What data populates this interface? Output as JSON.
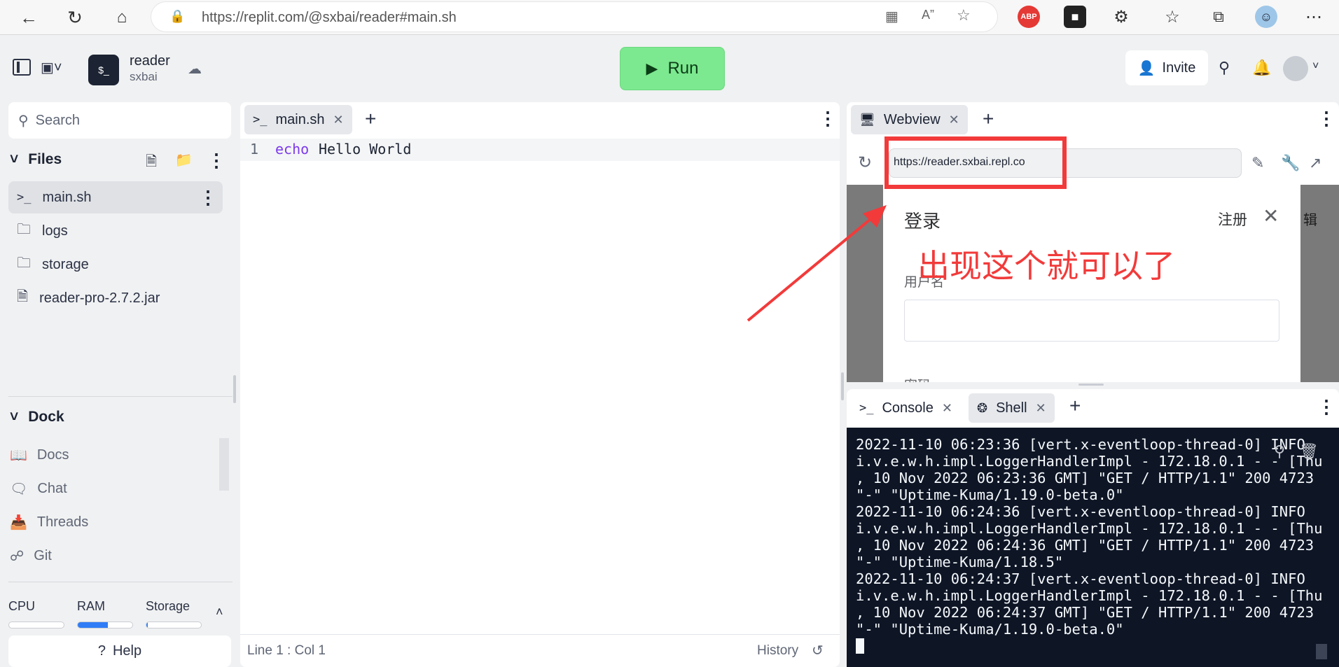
{
  "browser": {
    "url": "https://replit.com/@sxbai/reader#main.sh"
  },
  "header": {
    "repl_name": "reader",
    "owner": "sxbai",
    "run_label": "Run",
    "invite_label": "Invite"
  },
  "sidebar": {
    "search_placeholder": "Search",
    "files_heading": "Files",
    "files": [
      {
        "name": "main.sh",
        "icon": "terminal-icon"
      },
      {
        "name": "logs",
        "icon": "folder-icon"
      },
      {
        "name": "storage",
        "icon": "folder-icon"
      },
      {
        "name": "reader-pro-2.7.2.jar",
        "icon": "file-icon"
      }
    ],
    "dock_heading": "Dock",
    "dock": [
      {
        "name": "Docs",
        "icon": "book-icon"
      },
      {
        "name": "Chat",
        "icon": "chat-icon"
      },
      {
        "name": "Threads",
        "icon": "inbox-icon"
      },
      {
        "name": "Git",
        "icon": "git-icon"
      }
    ],
    "resources": [
      {
        "label": "CPU",
        "level": 0.0
      },
      {
        "label": "RAM",
        "level": 0.55
      },
      {
        "label": "Storage",
        "level": 0.02
      }
    ],
    "help_label": "Help"
  },
  "editor": {
    "tab_label": "main.sh",
    "line_number": "1",
    "code_keyword": "echo",
    "code_rest": "Hello World",
    "cursor_position": "Line 1 : Col 1",
    "history_label": "History"
  },
  "webview": {
    "tab_label": "Webview",
    "url": "https://reader.sxbai.repl.co",
    "login_title": "登录",
    "register_label": "注册",
    "username_label": "用户名",
    "password_label_partial": "密码",
    "annotation": "出现这个就可以了"
  },
  "console": {
    "console_tab": "Console",
    "shell_tab": "Shell",
    "lines": [
      "2022-11-10 06:23:36 [vert.x-eventloop-thread-0] INFO",
      "i.v.e.w.h.impl.LoggerHandlerImpl - 172.18.0.1 - - [Thu",
      ", 10 Nov 2022 06:23:36 GMT] \"GET / HTTP/1.1\" 200 4723",
      "\"-\" \"Uptime-Kuma/1.19.0-beta.0\"",
      "2022-11-10 06:24:36 [vert.x-eventloop-thread-0] INFO",
      "i.v.e.w.h.impl.LoggerHandlerImpl - 172.18.0.1 - - [Thu",
      ", 10 Nov 2022 06:24:36 GMT] \"GET / HTTP/1.1\" 200 4723",
      "\"-\" \"Uptime-Kuma/1.18.5\"",
      "2022-11-10 06:24:37 [vert.x-eventloop-thread-0] INFO",
      "i.v.e.w.h.impl.LoggerHandlerImpl - 172.18.0.1 - - [Thu",
      ", 10 Nov 2022 06:24:37 GMT] \"GET / HTTP/1.1\" 200 4723",
      "\"-\" \"Uptime-Kuma/1.19.0-beta.0\""
    ]
  },
  "colors": {
    "run_green": "#7ce88f",
    "annotation_red": "#f23a3a",
    "terminal_bg": "#0e1525",
    "keyword_purple": "#7c3aed"
  }
}
